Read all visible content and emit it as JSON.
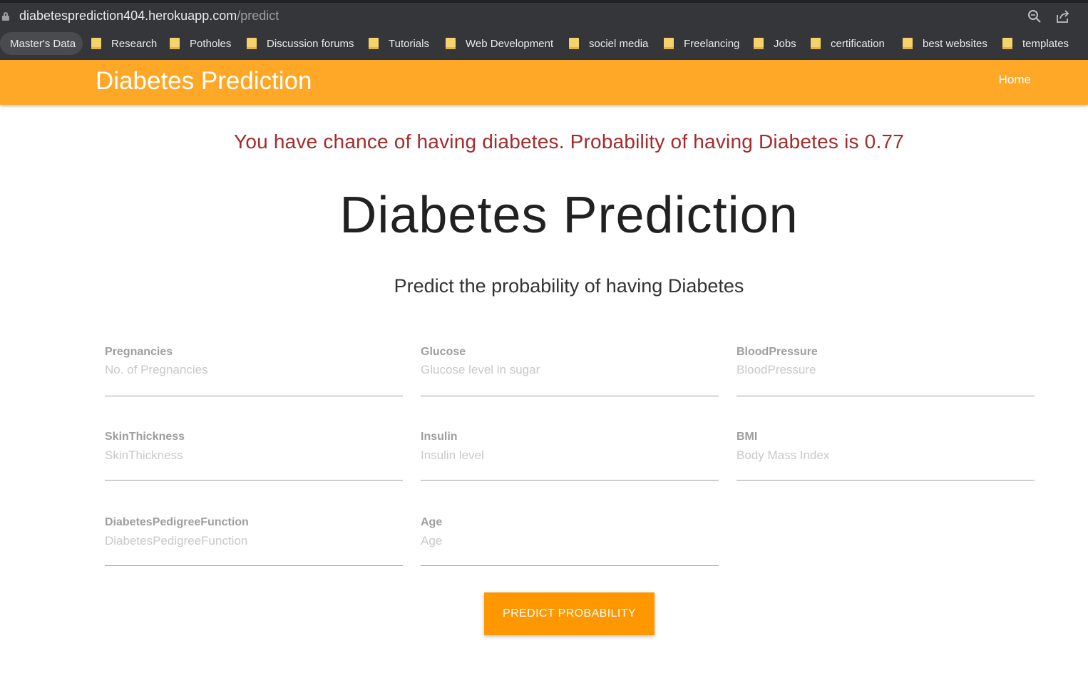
{
  "browser": {
    "url_host": "diabetesprediction404.herokuapp.com",
    "url_path": "/predict",
    "bookmarks": [
      {
        "label": "Master's Data",
        "active": true
      },
      {
        "label": "Research"
      },
      {
        "label": "Potholes"
      },
      {
        "label": "Discussion forums"
      },
      {
        "label": "Tutorials"
      },
      {
        "label": "Web Development"
      },
      {
        "label": "sociel media"
      },
      {
        "label": "Freelancing"
      },
      {
        "label": "Jobs"
      },
      {
        "label": "certification"
      },
      {
        "label": "best websites"
      },
      {
        "label": "templates"
      }
    ],
    "icons": [
      "lock-icon",
      "zoom-icon",
      "share-icon"
    ]
  },
  "navbar": {
    "brand": "Diabetes Prediction",
    "home": "Home",
    "color": "#ffa726"
  },
  "result": {
    "text": "You have chance of having diabetes. Probability of having Diabetes is 0.77",
    "color": "#a52a2a"
  },
  "page": {
    "title": "Diabetes Prediction",
    "subtitle": "Predict the probability of having Diabetes"
  },
  "form": {
    "fields": [
      {
        "label": "Pregnancies",
        "placeholder": "No. of Pregnancies",
        "value": ""
      },
      {
        "label": "Glucose",
        "placeholder": "Glucose level in sugar",
        "value": ""
      },
      {
        "label": "BloodPressure",
        "placeholder": "BloodPressure",
        "value": ""
      },
      {
        "label": "SkinThickness",
        "placeholder": "SkinThickness",
        "value": ""
      },
      {
        "label": "Insulin",
        "placeholder": "Insulin level",
        "value": ""
      },
      {
        "label": "BMI",
        "placeholder": "Body Mass Index",
        "value": ""
      },
      {
        "label": "DiabetesPedigreeFunction",
        "placeholder": "DiabetesPedigreeFunction",
        "value": ""
      },
      {
        "label": "Age",
        "placeholder": "Age",
        "value": ""
      }
    ],
    "submit_label": "PREDICT PROBABILITY",
    "button_color": "#ff9800"
  }
}
